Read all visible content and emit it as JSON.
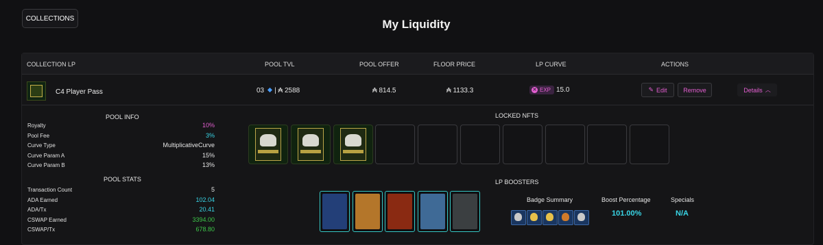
{
  "header": {
    "collections_button": "COLLECTIONS",
    "title": "My Liquidity"
  },
  "table": {
    "columns": [
      "COLLECTION LP",
      "POOL TVL",
      "POOL OFFER",
      "FLOOR PRICE",
      "LP CURVE",
      "ACTIONS"
    ],
    "row": {
      "name": "C4 Player Pass",
      "tvl_count": "03",
      "tvl_amount": "| ₳ 2588",
      "pool_offer": "₳ 814.5",
      "floor_price": "₳ 1133.3",
      "curve_badge": "EXP",
      "curve_value": "15.0",
      "edit_label": "Edit",
      "remove_label": "Remove",
      "details_label": "Details"
    }
  },
  "pool_info": {
    "title": "POOL INFO",
    "items": [
      {
        "label": "Royalty",
        "value": "10%",
        "color": "#e55fd2"
      },
      {
        "label": "Pool Fee",
        "value": "3%",
        "color": "#39d5e6"
      },
      {
        "label": "Curve Type",
        "value": "MultiplicativeCurve",
        "color": "#e6e6e6"
      },
      {
        "label": "Curve Param A",
        "value": "15%",
        "color": "#e6e6e6"
      },
      {
        "label": "Curve Param B",
        "value": "13%",
        "color": "#e6e6e6"
      }
    ]
  },
  "pool_stats": {
    "title": "POOL STATS",
    "items": [
      {
        "label": "Transaction Count",
        "value": "5",
        "color": "#e6e6e6"
      },
      {
        "label": "ADA Earned",
        "value": "102.04",
        "color": "#39d5e6"
      },
      {
        "label": "ADA/Tx",
        "value": "20.41",
        "color": "#39d5e6"
      },
      {
        "label": "CSWAP Earned",
        "value": "3394.00",
        "color": "#3ec84a"
      },
      {
        "label": "CSWAP/Tx",
        "value": "678.80",
        "color": "#3ec84a"
      }
    ]
  },
  "locked_nfts": {
    "title": "LOCKED NFTS",
    "filled_count": 3,
    "total_slots": 10
  },
  "lp_boosters": {
    "title": "LP BOOSTERS",
    "badge_summary_label": "Badge Summary",
    "boost_percentage_label": "Boost Percentage",
    "boost_percentage_value": "101.00%",
    "specials_label": "Specials",
    "specials_value": "N/A"
  },
  "colors": {
    "accent_pink": "#e55fd2",
    "accent_cyan": "#39d5e6",
    "accent_green": "#3ec84a"
  }
}
